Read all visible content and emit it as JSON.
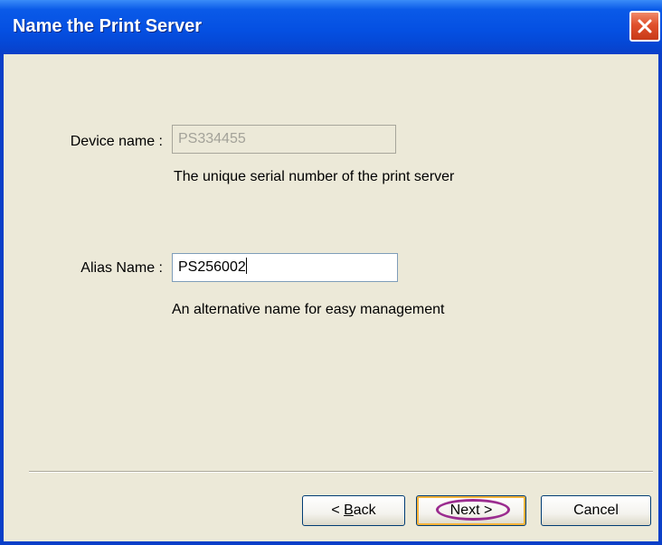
{
  "window": {
    "title": "Name the Print Server"
  },
  "device": {
    "label": "Device name :",
    "value": "PS334455",
    "hint": "The unique serial number of the print server"
  },
  "alias": {
    "label": "Alias Name :",
    "value": "PS256002",
    "hint": "An alternative name for easy management"
  },
  "buttons": {
    "back_prefix": "< ",
    "back_mnemonic": "B",
    "back_rest": "ack",
    "next_label": "Next >",
    "cancel_label": "Cancel"
  },
  "colors": {
    "titlebar": "#0550e2",
    "close": "#e0502c",
    "highlight": "#9b2c8f",
    "dialog_bg": "#ece9d8"
  },
  "icons": {
    "close": "close-icon"
  }
}
